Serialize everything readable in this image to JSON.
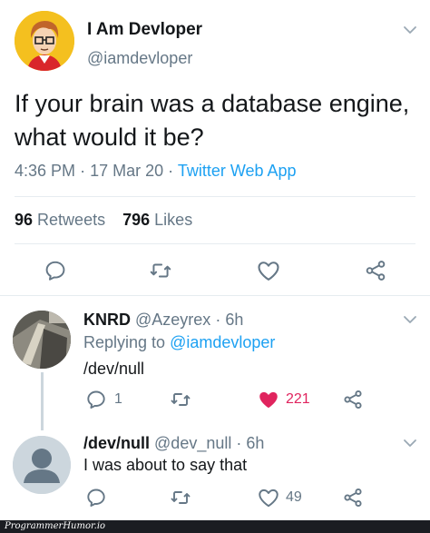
{
  "tweet": {
    "author": {
      "name": "I Am Devloper",
      "handle": "@iamdevloper"
    },
    "text": "If your brain was a database engine, what would it be?",
    "time": "4:36 PM",
    "date": "17 Mar 20",
    "separator": "·",
    "source": "Twitter Web App",
    "stats": {
      "retweets_count": "96",
      "retweets_label": "Retweets",
      "likes_count": "796",
      "likes_label": "Likes"
    }
  },
  "replies": [
    {
      "name": "KNRD",
      "handle": "@Azeyrex",
      "separator": "·",
      "time": "6h",
      "replying_label": "Replying to",
      "replying_to": "@iamdevloper",
      "text": "/dev/null",
      "reply_count": "1",
      "retweet_count": "",
      "like_count": "221",
      "liked": true
    },
    {
      "name": "/dev/null",
      "handle": "@dev_null",
      "separator": "·",
      "time": "6h",
      "text": "I was about to say that",
      "reply_count": "",
      "retweet_count": "",
      "like_count": "49",
      "liked": false
    }
  ],
  "icons": {
    "reply": "reply-icon",
    "retweet": "retweet-icon",
    "like": "heart-icon",
    "share": "share-icon",
    "caret": "chevron-down-icon"
  },
  "colors": {
    "accent": "#1da1f2",
    "like_active": "#e0245e",
    "muted": "#657786",
    "text": "#14171a"
  },
  "watermark": "ProgrammerHumor.io"
}
